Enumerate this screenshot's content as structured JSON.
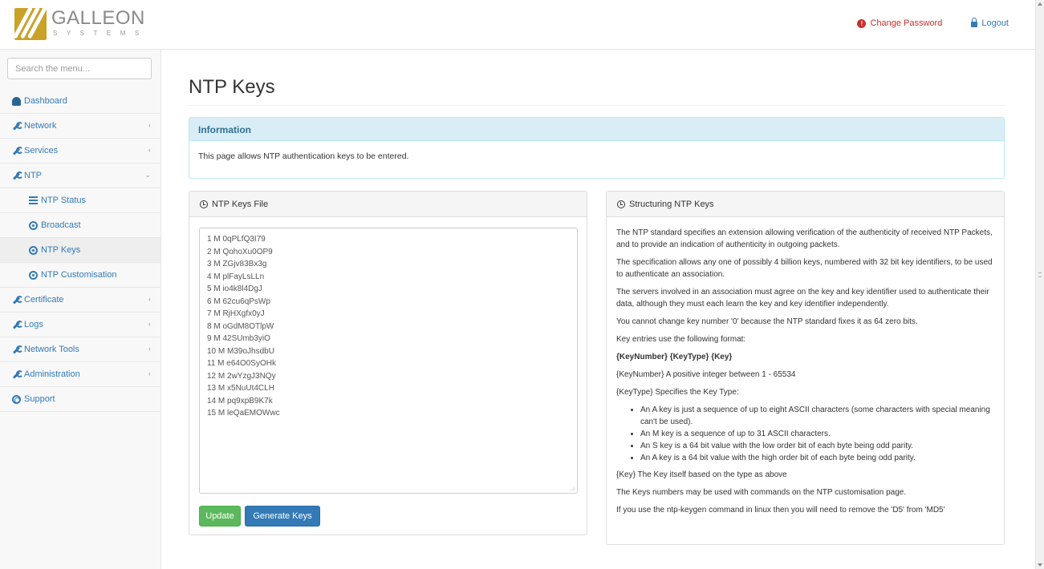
{
  "header": {
    "logo_text": "GALLEON",
    "logo_sub": "SYSTEMS",
    "change_password": "Change Password",
    "logout": "Logout"
  },
  "sidebar": {
    "search_placeholder": "Search the menu...",
    "items": [
      {
        "label": "Dashboard",
        "icon": "dashboard-icon"
      },
      {
        "label": "Network",
        "icon": "wrench-icon",
        "chevron": "‹"
      },
      {
        "label": "Services",
        "icon": "wrench-icon",
        "chevron": "‹"
      },
      {
        "label": "NTP",
        "icon": "wrench-icon",
        "chevron": "⌄"
      },
      {
        "label": "NTP Status",
        "icon": "list-icon",
        "sub": true
      },
      {
        "label": "Broadcast",
        "icon": "globe-icon",
        "sub": true
      },
      {
        "label": "NTP Keys",
        "icon": "globe-icon",
        "sub": true,
        "active": true
      },
      {
        "label": "NTP Customisation",
        "icon": "globe-icon",
        "sub": true
      },
      {
        "label": "Certificate",
        "icon": "wrench-icon",
        "chevron": "‹"
      },
      {
        "label": "Logs",
        "icon": "wrench-icon",
        "chevron": "‹"
      },
      {
        "label": "Network Tools",
        "icon": "wrench-icon",
        "chevron": "‹"
      },
      {
        "label": "Administration",
        "icon": "wrench-icon",
        "chevron": "‹"
      },
      {
        "label": "Support",
        "icon": "support-icon"
      }
    ]
  },
  "main": {
    "title": "NTP Keys",
    "info": {
      "heading": "Information",
      "text": "This page allows NTP authentication keys to be entered."
    },
    "keys_panel": {
      "heading": "NTP Keys File",
      "keys": [
        "1 M 0qPLfQ3I79",
        "2 M QohoXu0OP9",
        "3 M ZGjv83Bx3g",
        "4 M plFayLsLLn",
        "5 M io4k8l4DgJ",
        "6 M 62cu6qPsWp",
        "7 M RjHXgfx0yJ",
        "8 M oGdM8OTlpW",
        "9 M 42SUmb3yiO",
        "10 M M39oJhsdbU",
        "11 M e64O0SyOHk",
        "12 M 2wYzgJ3NQy",
        "13 M x5NuUt4CLH",
        "14 M pq9xpB9K7k",
        "15 M leQaEMOWwc"
      ],
      "update_label": "Update",
      "generate_label": "Generate Keys"
    },
    "struct_panel": {
      "heading": "Structuring NTP Keys",
      "p1": "The NTP standard specifies an extension allowing verification of the authenticity of received NTP Packets, and to provide an indication of authenticity in outgoing packets.",
      "p2": "The specification allows any one of possibly 4 billion keys, numbered with 32 bit key identifiers, to be used to authenticate an association.",
      "p3": "The servers involved in an association must agree on the key and key identifier used to authenticate their data, although they must each learn the key and key identifier independently.",
      "p4": "You cannot change key number '0' because the NTP standard fixes it as 64 zero bits.",
      "p5": "Key entries use the following format:",
      "format": "{KeyNumber} {KeyType} {Key}",
      "p6": "{KeyNumber} A positive integer between 1 - 65534",
      "p7": "{KeyType} Specifies the Key Type:",
      "bullets": [
        "An A key is just a sequence of up to eight ASCII characters (some characters with special meaning can't be used).",
        "An M key is a sequence of up to 31 ASCII characters.",
        "An S key is a 64 bit value with the low order bit of each byte being odd parity.",
        "An A key is a 64 bit value with the high order bit of each byte being odd parity."
      ],
      "p8": "{Key} The Key itself based on the type as above",
      "p9": "The Keys numbers may be used with commands on the NTP customisation page.",
      "p10": "If you use the ntp-keygen command in linux then you will need to remove the 'D5' from 'MD5'"
    }
  }
}
